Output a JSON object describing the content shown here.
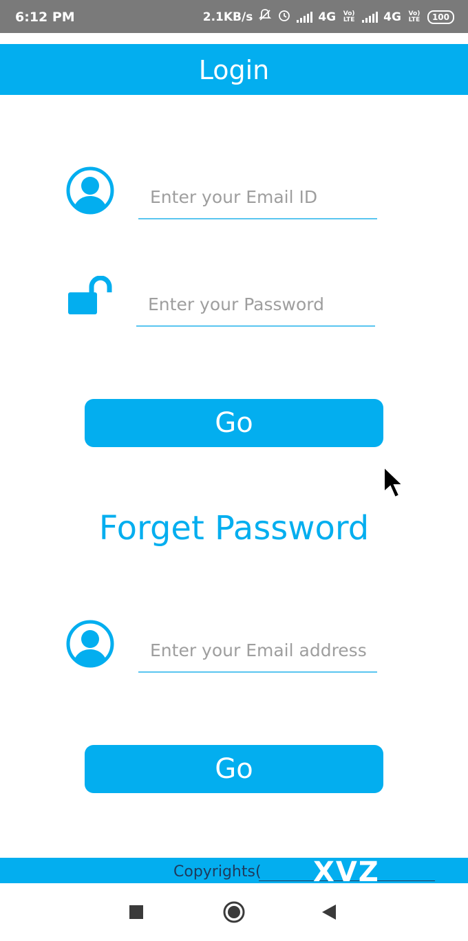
{
  "status_bar": {
    "time": "6:12 PM",
    "net_speed": "2.1KB/s",
    "network_1": "4G",
    "volte_1": "Vo) LTE",
    "network_2": "4G",
    "volte_2": "Vo) LTE",
    "battery": "100",
    "icons": [
      "notifications-off-icon",
      "alarm-icon",
      "signal-icon",
      "signal-icon",
      "battery-icon"
    ]
  },
  "app_bar": {
    "title": "Login"
  },
  "login": {
    "email_placeholder": "Enter your Email ID",
    "password_placeholder": "Enter your Password",
    "go_label": "Go"
  },
  "forgot": {
    "heading": "Forget Password",
    "email_placeholder": "Enter your Email address",
    "go_label": "Go"
  },
  "footer": {
    "copyright_text": "Copyrights(",
    "brand": "XVZ"
  },
  "nav": {
    "icons": [
      "recents-square-icon",
      "home-circle-icon",
      "back-triangle-icon"
    ]
  },
  "colors": {
    "primary": "#03aeef",
    "status_bar": "#7a7a7a",
    "hint_text": "#9e9e9e"
  }
}
